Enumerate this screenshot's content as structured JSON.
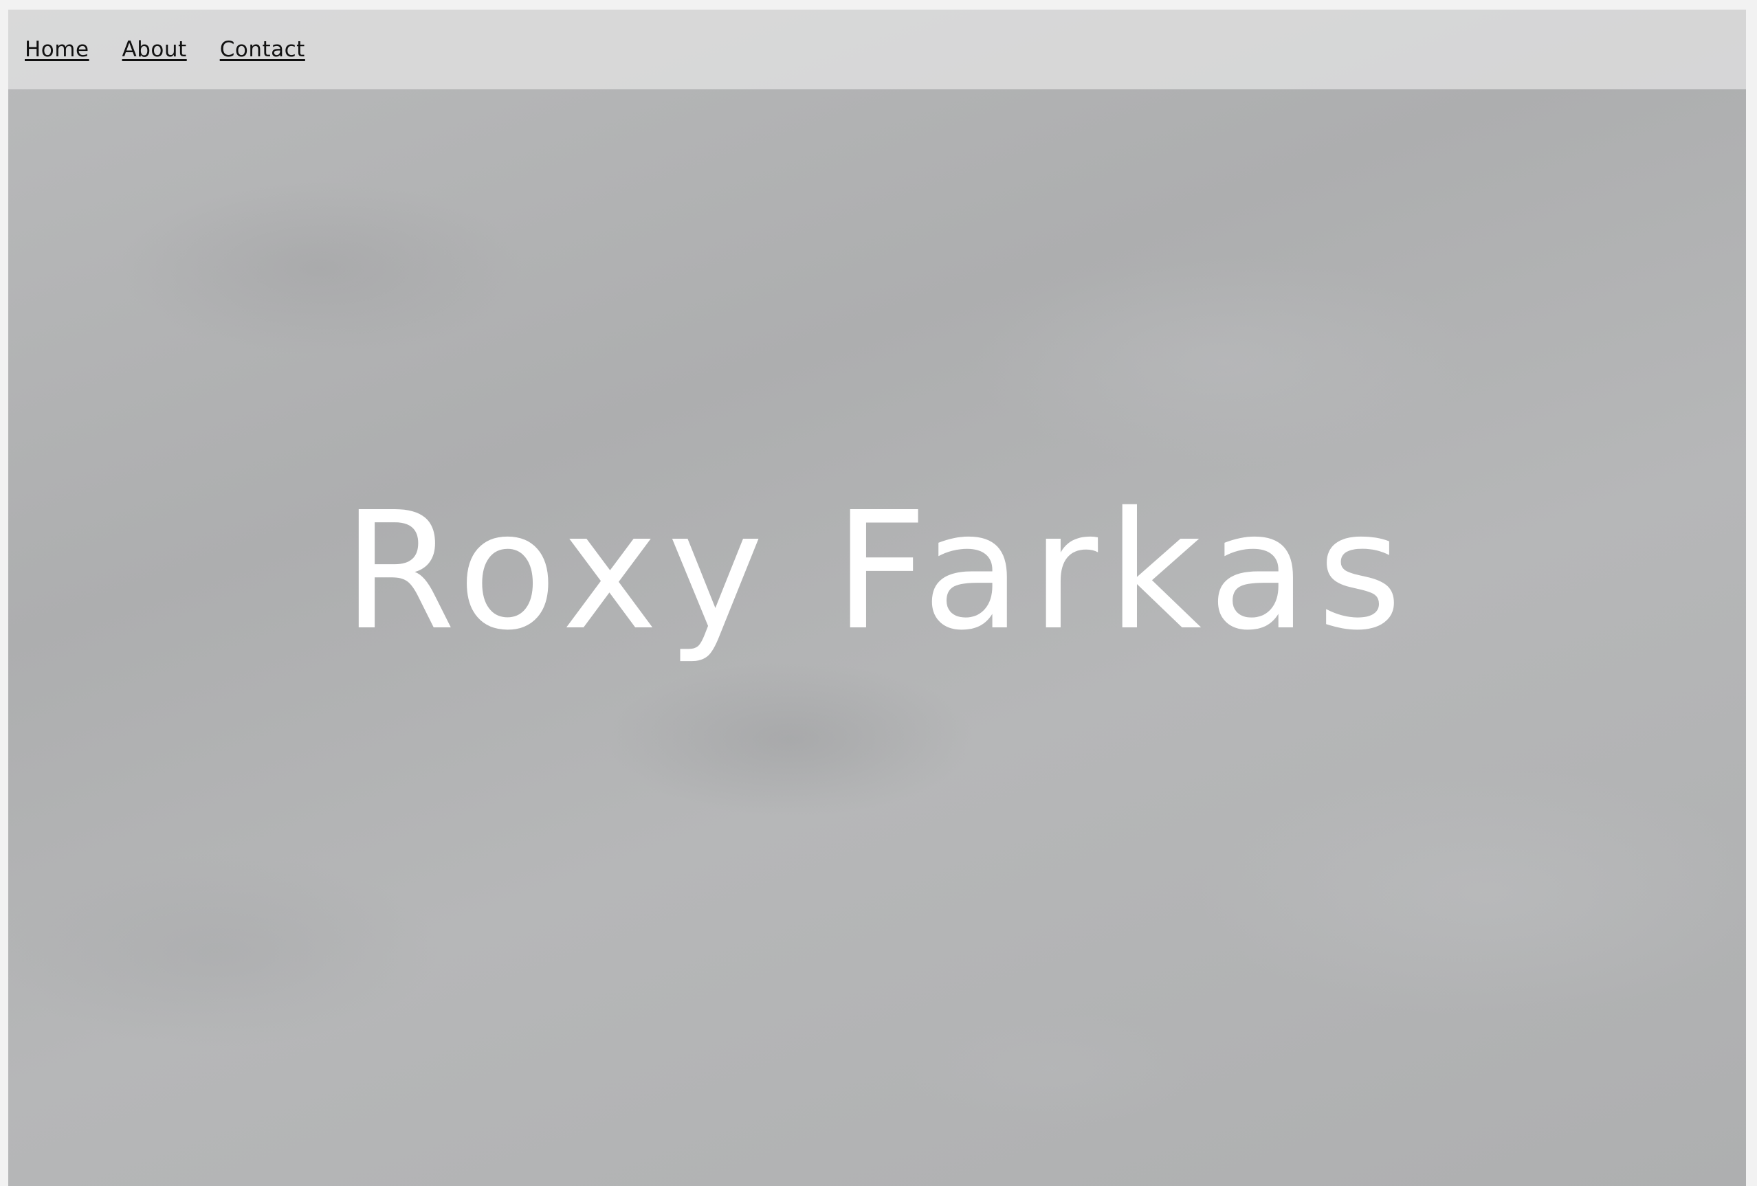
{
  "nav": {
    "items": [
      {
        "label": "Home"
      },
      {
        "label": "About"
      },
      {
        "label": "Contact"
      }
    ]
  },
  "hero": {
    "title": "Roxy Farkas"
  },
  "colors": {
    "nav_background": "#e1e1e2",
    "title_text": "#ffffff",
    "link_text": "#111111",
    "page_background": "#b3b4b5"
  }
}
